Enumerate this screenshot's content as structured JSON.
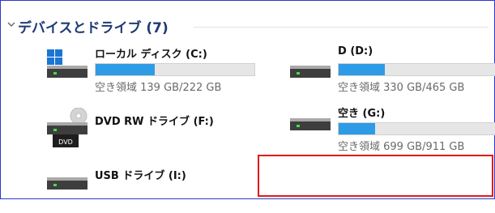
{
  "section": {
    "title": "デバイスとドライブ (7)"
  },
  "drives": [
    {
      "name": "ローカル ディスク (C:)",
      "free_text": "空き領域 139 GB/222 GB",
      "used_fraction": 0.37
    },
    {
      "name": "D (D:)",
      "free_text": "空き領域 330 GB/465 GB",
      "used_fraction": 0.29
    },
    {
      "name": "DVD RW ドライブ (F:)",
      "dvd_label": "DVD"
    },
    {
      "name": "空き (G:)",
      "free_text": "空き領域 699 GB/911 GB",
      "used_fraction": 0.23
    },
    {
      "name": "USB ドライブ (I:)"
    }
  ],
  "colors": {
    "accent_bar": "#2e9be6",
    "header_text": "#1e3a75",
    "panel_border": "#2b39c9",
    "highlight_box": "#e01b1b"
  }
}
